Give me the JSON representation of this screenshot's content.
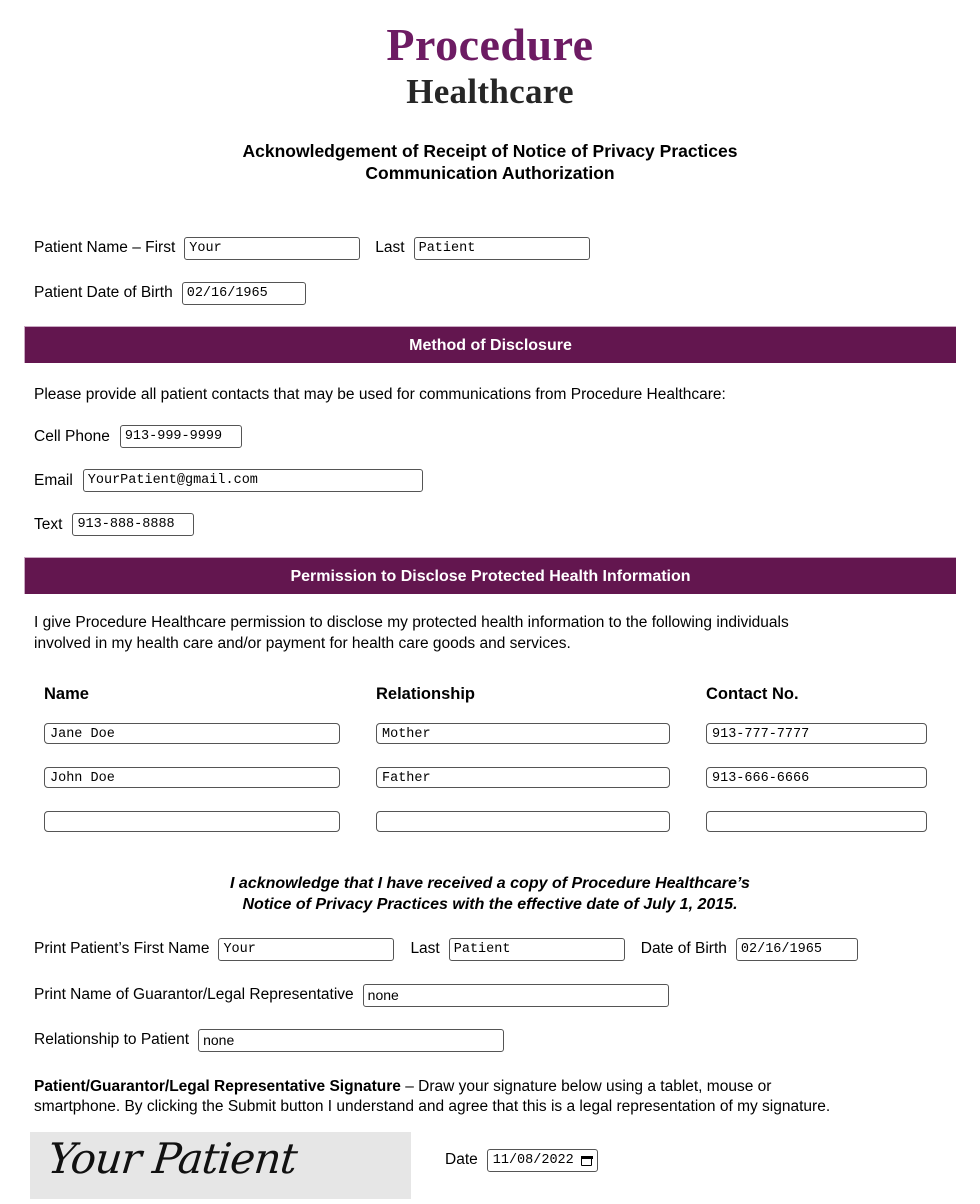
{
  "logo": {
    "line1": "Procedure",
    "line2": "Healthcare",
    "brand_purple": "#6d1b63",
    "brand_dark": "#262626"
  },
  "title": {
    "line1": "Acknowledgement of Receipt of Notice of Privacy Practices",
    "line2": "Communication Authorization"
  },
  "patient": {
    "name_label": "Patient Name – First",
    "first_value": "Your",
    "last_label": "Last",
    "last_value": "Patient",
    "dob_label": "Patient Date of Birth",
    "dob_value": "02/16/1965"
  },
  "disclosure": {
    "banner": "Method of Disclosure",
    "banner_color": "#63164f",
    "intro": "Please provide all patient contacts that may be used for communications from Procedure Healthcare:",
    "cell_label": "Cell Phone",
    "cell_value": "913-999-9999",
    "email_label": "Email",
    "email_value": "YourPatient@gmail.com",
    "text_label": "Text",
    "text_value": "913-888-8888"
  },
  "permission": {
    "banner": "Permission to Disclose Protected Health Information",
    "paragraph_line1": "I give Procedure Healthcare permission to disclose my protected health information to the following individuals",
    "paragraph_line2": "involved in my health care and/or payment for health care goods and services.",
    "columns": [
      "Name",
      "Relationship",
      "Contact No."
    ],
    "rows": [
      {
        "name": "Jane Doe",
        "relationship": "Mother",
        "contact": "913-777-7777"
      },
      {
        "name": "John Doe",
        "relationship": "Father",
        "contact": "913-666-6666"
      },
      {
        "name": "",
        "relationship": "",
        "contact": ""
      }
    ]
  },
  "acknowledge": {
    "line1": "I acknowledge that I have received a copy of Procedure Healthcare’s",
    "line2": "Notice of Privacy Practices with the effective date of July 1, 2015."
  },
  "print": {
    "first_label": "Print Patient’s First Name",
    "first_value": "Your",
    "last_label": "Last",
    "last_value": "Patient",
    "dob_label": "Date of Birth",
    "dob_value": "02/16/1965",
    "guarantor_label": "Print Name of Guarantor/Legal Representative",
    "guarantor_value": "none",
    "relationship_label": "Relationship to Patient",
    "relationship_value": "none"
  },
  "signature": {
    "heading_bold": "Patient/Guarantor/Legal Representative Signature",
    "heading_rest": " – Draw your signature below using a tablet, mouse or",
    "heading_line2": "smartphone. By clicking the Submit button I understand and agree that this is a legal representation of my signature.",
    "drawn_text": "Your Patient",
    "canvas_color": "#e6e6e6",
    "date_label": "Date",
    "date_value": "11/08/2022",
    "date_icon": "calendar-icon"
  }
}
